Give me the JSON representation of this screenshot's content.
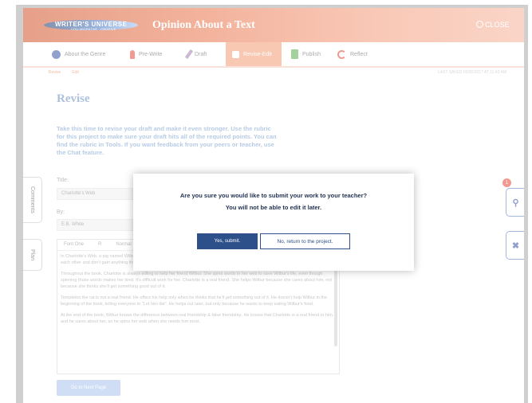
{
  "header": {
    "logo_text": "WRITER'S UNIVERSE",
    "logo_subtext": "COLLABORATIVE · CREATIVE",
    "title": "Opinion About a Text",
    "close_label": "CLOSE"
  },
  "tabs": [
    {
      "label": "About the Genre",
      "icon": "info-circle-icon"
    },
    {
      "label": "Pre-Write",
      "icon": "pin-icon"
    },
    {
      "label": "Draft",
      "icon": "pencil-icon"
    },
    {
      "label": "Revise-Edit",
      "icon": "hand-icon",
      "active": true
    },
    {
      "label": "Publish",
      "icon": "document-icon"
    },
    {
      "label": "Reflect",
      "icon": "reflect-icon"
    }
  ],
  "subtabs": [
    "Revise",
    "Edit"
  ],
  "autosave": "LAST SAVED 00/00/2017 AT 11:43 AM",
  "page_title": "Revise",
  "instructions": "Take this time to revise your draft and make it even stronger. Use the rubric for this project to make sure your draft hits all of the required points. You can find the rubric in Tools. If you want feedback from your peers or teacher, use the Chat feature.",
  "side_tabs": {
    "comments": "Comments",
    "plan": "Plan"
  },
  "form": {
    "title_label": "Title:",
    "title_value": "Charlotte's Web",
    "by_label": "By:",
    "by_value": "E.B. White"
  },
  "editor": {
    "font": "Font One",
    "size": "R",
    "style": "Normal",
    "paragraphs": [
      "In Charlotte's Web, a pig named Wilbur is saved from being killed by a spider named Charlotte. This story teaches us that real friends help each other and don't gain anything from it.",
      "Throughout the book, Charlotte is always willing to help her friend Wilbur. She spins words in her web to save Wilbur's life, even though spinning those words makes her tired. It's difficult work for her. Charlotte is a real friend. She helps Wilbur because she cares about him, not because she thinks she'll get something good out of it.",
      "Templeton the rat is not a real friend. He offers his help only when he thinks that he'll get something out of it. He doesn't help Wilbur in the beginning of the book, telling everyone to \"Let him die\". He helps out later, but only because he wants to keep eating Wilbur's food.",
      "At the end of the book, Wilbur knows the difference between real friendship & false friendship. He knows that Charlotte is a real friend to him, and he cares about her, so he spins her web when she needs him most."
    ]
  },
  "next_button": "Go to Next Page",
  "right_tabs": {
    "badge": "1"
  },
  "dialog": {
    "question": "Are you sure you would like to submit your work to your teacher?",
    "warning": "You will not be able to edit it later.",
    "yes_label": "Yes, submit.",
    "no_label": "No, return to the project."
  },
  "colors": {
    "accent": "#f29c74",
    "primary": "#2d4f8a",
    "link": "#7b9fd0"
  }
}
